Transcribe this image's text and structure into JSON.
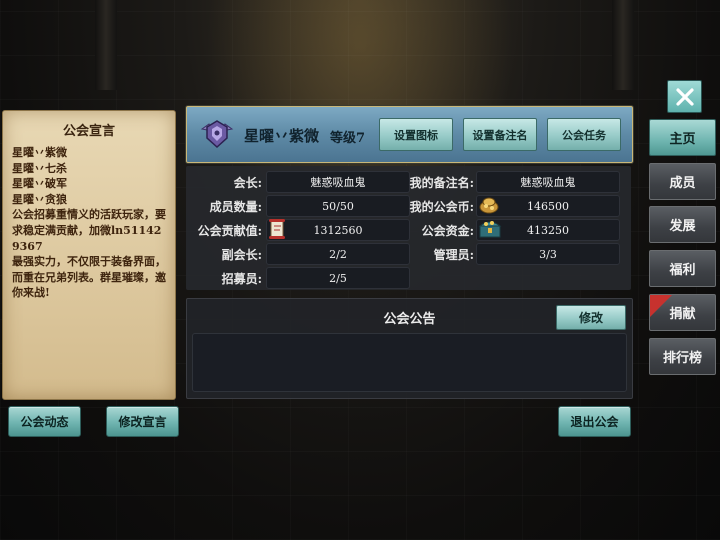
{
  "declaration": {
    "title": "公会宣言",
    "lines": [
      "星曜丷紫微",
      "星曜丷七杀",
      "星曜丷破军",
      "星曜丷贪狼",
      "公会招募重情义的活跃玩家，要求稳定满贡献，加微ln511429367",
      "最强实力，不仅限于装备界面，而重在兄弟列表。群星璀璨，邀你来战!"
    ],
    "guild_dynamics_button": "公会动态",
    "edit_declaration_button": "修改宣言"
  },
  "header": {
    "guild_name": "星曜丷紫微",
    "level_text": "等级7",
    "buttons": [
      "设置图标",
      "设置备注名",
      "公会任务"
    ]
  },
  "info": {
    "leader_label": "会长:",
    "leader_value": "魅惑吸血鬼",
    "note_name_label": "我的备注名:",
    "note_name_value": "魅惑吸血鬼",
    "member_count_label": "成员数量:",
    "member_count_value": "50/50",
    "my_coin_label": "我的公会币:",
    "my_coin_value": "146500",
    "contribution_label": "公会贡献值:",
    "contribution_value": "1312560",
    "funds_label": "公会资金:",
    "funds_value": "413250",
    "vice_leader_label": "副会长:",
    "vice_leader_value": "2/2",
    "admin_label": "管理员:",
    "admin_value": "3/3",
    "recruiter_label": "招募员:",
    "recruiter_value": "2/5"
  },
  "notice": {
    "title": "公会公告",
    "edit_button": "修改",
    "content": ""
  },
  "exit_button": "退出公会",
  "nav": {
    "items": [
      "主页",
      "成员",
      "发展",
      "福利",
      "捐献",
      "排行榜"
    ],
    "active": "主页",
    "ribbon_color": "#c7322e"
  },
  "colors": {
    "accent": "#6fb5b0",
    "panel": "#26282c"
  }
}
